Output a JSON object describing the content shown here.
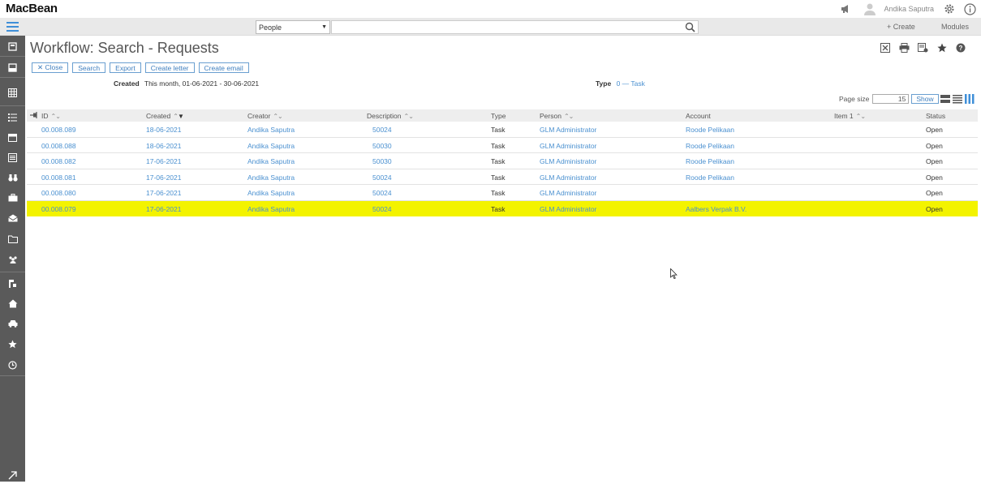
{
  "app": {
    "logo": "MacBean",
    "user": "Andika Saputra"
  },
  "search": {
    "category": "People",
    "placeholder": ""
  },
  "topbar": {
    "create_label": "+ Create",
    "modules_label": "Modules"
  },
  "page": {
    "title": "Workflow: Search - Requests"
  },
  "actions": [
    {
      "label": "✕ Close",
      "name": "close-button"
    },
    {
      "label": "Search",
      "name": "search-button"
    },
    {
      "label": "Export",
      "name": "export-button"
    },
    {
      "label": "Create letter",
      "name": "create-letter-button"
    },
    {
      "label": "Create email",
      "name": "create-email-button"
    }
  ],
  "filters": {
    "created_label": "Created",
    "created_value": "This month, 01-06-2021 - 30-06-2021",
    "type_label": "Type",
    "type_value": "0 — Task"
  },
  "pagination": {
    "page_size_label": "Page size",
    "page_size_value": "15",
    "show_label": "Show"
  },
  "table": {
    "columns": [
      "ID",
      "Created",
      "Creator",
      "Description",
      "Type",
      "Person",
      "Account",
      "Item 1",
      "Status"
    ],
    "rows": [
      {
        "id": "00.008.089",
        "created": "18-06-2021",
        "creator": "Andika Saputra",
        "description": "50024",
        "type": "Task",
        "person": "GLM Administrator",
        "account": "Roode Pelikaan",
        "item1": "",
        "status": "Open"
      },
      {
        "id": "00.008.088",
        "created": "18-06-2021",
        "creator": "Andika Saputra",
        "description": "50030",
        "type": "Task",
        "person": "GLM Administrator",
        "account": "Roode Pelikaan",
        "item1": "",
        "status": "Open"
      },
      {
        "id": "00.008.082",
        "created": "17-06-2021",
        "creator": "Andika Saputra",
        "description": "50030",
        "type": "Task",
        "person": "GLM Administrator",
        "account": "Roode Pelikaan",
        "item1": "",
        "status": "Open"
      },
      {
        "id": "00.008.081",
        "created": "17-06-2021",
        "creator": "Andika Saputra",
        "description": "50024",
        "type": "Task",
        "person": "GLM Administrator",
        "account": "Roode Pelikaan",
        "item1": "",
        "status": "Open"
      },
      {
        "id": "00.008.080",
        "created": "17-06-2021",
        "creator": "Andika Saputra",
        "description": "50024",
        "type": "Task",
        "person": "GLM Administrator",
        "account": "",
        "item1": "",
        "status": "Open"
      },
      {
        "id": "00.008.079",
        "created": "17-06-2021",
        "creator": "Andika Saputra",
        "description": "50024",
        "type": "Task",
        "person": "GLM Administrator",
        "account": "Aalbers Verpak B.V.",
        "item1": "",
        "status": "Open",
        "highlighted": true
      }
    ]
  },
  "colors": {
    "link": "#4a90d0",
    "highlight": "#f3f300",
    "sidebar": "#5a5a5a",
    "accent": "#3f7fbf"
  },
  "sidebar_icons": [
    "dashboard-icon",
    "inbox-icon",
    "grid-icon",
    "checklist-icon",
    "calendar-icon",
    "list-icon",
    "binoculars-icon",
    "briefcase-icon",
    "mail-icon",
    "folder-icon",
    "group-icon",
    "route-icon",
    "home-icon",
    "car-icon",
    "star-icon",
    "clock-icon",
    "expand-icon"
  ]
}
